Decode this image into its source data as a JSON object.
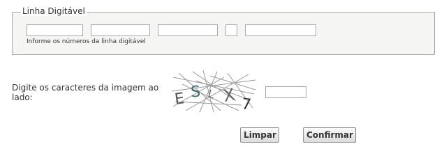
{
  "linha_digitavel": {
    "legend": "Linha Digitável",
    "hint": "Informe os números da linha digitável",
    "fields": [
      {
        "value": ""
      },
      {
        "value": ""
      },
      {
        "value": ""
      },
      {
        "value": ""
      },
      {
        "value": ""
      }
    ]
  },
  "captcha": {
    "label": "Digite os caracteres da imagem ao lado:",
    "characters": [
      "E",
      "S",
      "L",
      "X",
      "7"
    ],
    "input_value": ""
  },
  "buttons": {
    "clear_label": "Limpar",
    "confirm_label": "Confirmar"
  }
}
